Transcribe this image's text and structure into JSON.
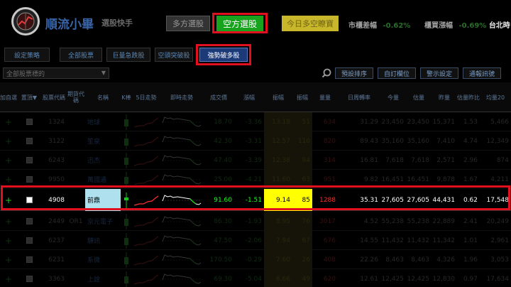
{
  "app": {
    "name": "順流小畢",
    "subtitle": "選股快手",
    "buttons": {
      "long": "多方選股",
      "short": "空方選股",
      "today": "今日多空瞭寶"
    },
    "tickers": [
      {
        "label": "市櫃差幅",
        "value": "-0.62%"
      },
      {
        "label": "櫃買漲幅",
        "value": "-0.69%"
      },
      {
        "label": "台北時",
        "value": ""
      }
    ]
  },
  "tabs": [
    "設定策略",
    "全部股票",
    "巨量急跌股",
    "空頭突破股",
    "強勢破多股"
  ],
  "active_tab": "強勢破多股",
  "filter": {
    "select_value": "全部股票標的",
    "buttons": [
      "預設排序",
      "自訂欄位",
      "警示設定",
      "通報訊號"
    ]
  },
  "colors": {
    "alert_red": "#e0101e",
    "active_green": "#17a31d",
    "highlight_yellow": "#ffff00"
  },
  "table": {
    "headers": [
      "加自選",
      "置頂▼",
      "股票代碼",
      "期貨代碼",
      "名稱",
      "K棒",
      "5日走勢",
      "即時走勢",
      "成交價",
      "漲幅",
      "振幅",
      "振幅",
      "量量",
      "日周轉率",
      "今量",
      "估量",
      "昨量",
      "估量昨比",
      "均量20"
    ],
    "rows": [
      {
        "code": "1324",
        "fut": "",
        "name": "地球",
        "price": "18.70",
        "chg": "-3.36",
        "amp": "13.18",
        "amp2": "51",
        "vol": "634",
        "turn": "31.29",
        "today": "23,450",
        "est": "23,450",
        "yest": "15,371",
        "ratio": "1.53",
        "avg": "5,466"
      },
      {
        "code": "3122",
        "fut": "",
        "name": "笙泉",
        "price": "42.30",
        "chg": "-3.31",
        "amp": "12.57",
        "amp2": "110",
        "vol": "820",
        "turn": "89.43",
        "today": "35,160",
        "est": "35,160",
        "yest": "7,410",
        "ratio": "4.74",
        "avg": "12,349"
      },
      {
        "code": "6243",
        "fut": "",
        "name": "迅杰",
        "price": "47.40",
        "chg": "-3.39",
        "amp": "12.38",
        "amp2": "94",
        "vol": "314",
        "turn": "16.81",
        "today": "7,618",
        "est": "7,618",
        "yest": "2,571",
        "ratio": "2.96",
        "avg": "874"
      },
      {
        "code": "9950",
        "fut": "",
        "name": "萬國通",
        "price": "25.00",
        "chg": "-4.21",
        "amp": "11.60",
        "amp2": "63",
        "vol": "951",
        "turn": "9.82",
        "today": "16,451",
        "est": "16,451",
        "yest": "9,878",
        "ratio": "1.67",
        "avg": "4,211"
      },
      {
        "code": "4908",
        "fut": "",
        "name": "前鼎",
        "price": "91.60",
        "chg": "-1.51",
        "amp": "9.14",
        "amp2": "85",
        "vol": "1288",
        "turn": "35.31",
        "today": "27,605",
        "est": "27,605",
        "yest": "44,431",
        "ratio": "0.62",
        "avg": "17,548"
      },
      {
        "code": "2449",
        "fut": "OR1",
        "name": "京元電子",
        "price": "86.30",
        "chg": "-1.93",
        "amp": "8.95",
        "amp2": "76",
        "vol": "3017",
        "turn": "4.52",
        "today": "55,238",
        "est": "55,238",
        "yest": "22,889",
        "ratio": "2.41",
        "avg": "20,249"
      },
      {
        "code": "6237",
        "fut": "",
        "name": "驊訊",
        "price": "47.50",
        "chg": "-2.06",
        "amp": "7.94",
        "amp2": "67",
        "vol": "676",
        "turn": "14.55",
        "today": "11,432",
        "est": "11,432",
        "yest": "11,342",
        "ratio": "1.01",
        "avg": "2,961"
      },
      {
        "code": "6231",
        "fut": "",
        "name": "系微",
        "price": "170.50",
        "chg": "-0.29",
        "amp": "7.60",
        "amp2": "26",
        "vol": "408",
        "turn": "22.26",
        "today": "8,463",
        "est": "8,463",
        "yest": "4,326",
        "ratio": "1.96",
        "avg": "3,053"
      },
      {
        "code": "3363",
        "fut": "",
        "name": "上詮",
        "price": "69.30",
        "chg": "-5.04",
        "amp": "6.66",
        "amp2": "49",
        "vol": "620",
        "turn": "12.61",
        "today": "12,425",
        "est": "12,425",
        "yest": "12,830",
        "ratio": "0.97",
        "avg": "17,634"
      }
    ]
  }
}
